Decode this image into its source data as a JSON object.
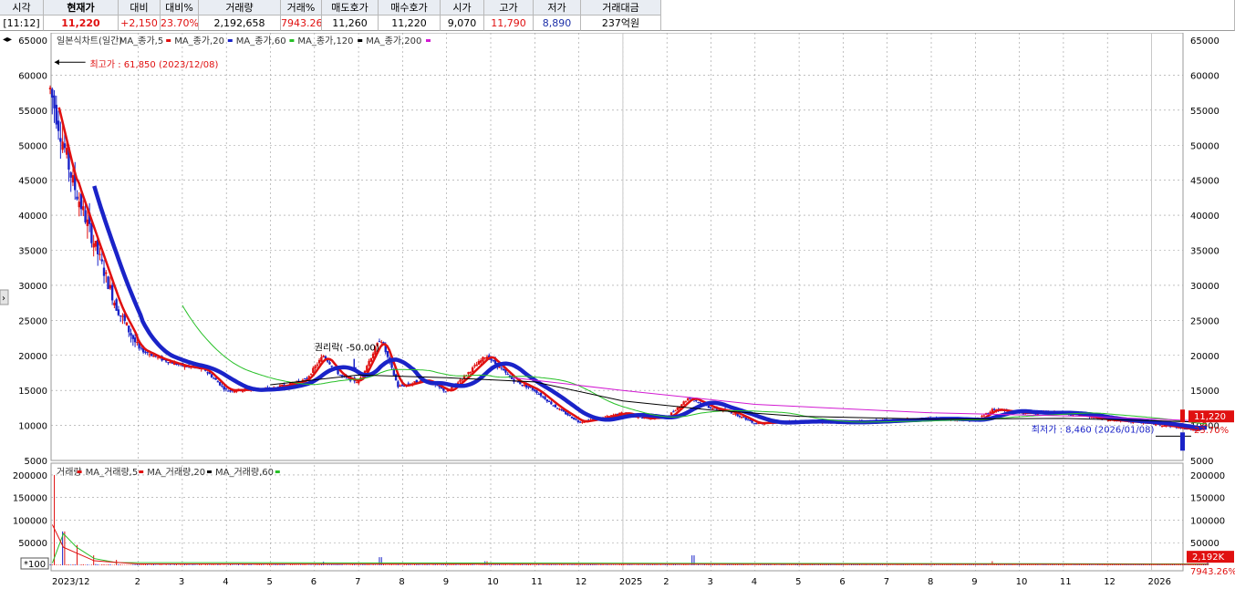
{
  "quote": {
    "headers": [
      "시각",
      "현재가",
      "대비",
      "대비%",
      "거래량",
      "거래%",
      "매도호가",
      "매수호가",
      "시가",
      "고가",
      "저가",
      "거래대금"
    ],
    "values": [
      "[11:12]",
      "11,220",
      "+2,150",
      "23.70%",
      "2,192,658",
      "7943.26%",
      "11,260",
      "11,220",
      "9,070",
      "11,790",
      "8,890",
      "237억원"
    ]
  },
  "colors": {
    "up": "#e01010",
    "down": "#1a23c8",
    "ma5": "#e01010",
    "ma20": "#1a23c8",
    "ma60": "#27c027",
    "ma120": "#000000",
    "ma200": "#d21ad2",
    "grid": "#9a9a9a"
  },
  "chart_data": {
    "type": "candlestick",
    "price_panel": {
      "legend": [
        "일본식차트(일간)",
        "MA_종가,5",
        "MA_종가,20",
        "MA_종가,60",
        "MA_종가,120",
        "MA_종가,200"
      ],
      "ylim": [
        5000,
        65000
      ],
      "yticks": [
        "65000",
        "60000",
        "55000",
        "50000",
        "45000",
        "40000",
        "35000",
        "30000",
        "25000",
        "20000",
        "15000",
        "10000",
        "5000"
      ],
      "high_annotation": "최고가 : 61,850 (2023/12/08)",
      "low_annotation": "최저가 : 8,460 (2026/01/08)",
      "event_annotation": "권리락( -50.00)",
      "current_price_tag": "11,220",
      "change_tag": "23.70%",
      "close_trend": [
        {
          "t": 0,
          "c": 58000
        },
        {
          "t": 0.5,
          "c": 45000
        },
        {
          "t": 1,
          "c": 36000
        },
        {
          "t": 1.5,
          "c": 27000
        },
        {
          "t": 2,
          "c": 21000
        },
        {
          "t": 2.5,
          "c": 19500
        },
        {
          "t": 3,
          "c": 18500
        },
        {
          "t": 3.5,
          "c": 18000
        },
        {
          "t": 4,
          "c": 15000
        },
        {
          "t": 5,
          "c": 15200
        },
        {
          "t": 5.8,
          "c": 16500
        },
        {
          "t": 6.2,
          "c": 20000
        },
        {
          "t": 6.6,
          "c": 17000
        },
        {
          "t": 7,
          "c": 16200
        },
        {
          "t": 7.5,
          "c": 22500
        },
        {
          "t": 7.9,
          "c": 15500
        },
        {
          "t": 8.5,
          "c": 16500
        },
        {
          "t": 9,
          "c": 14800
        },
        {
          "t": 9.4,
          "c": 17000
        },
        {
          "t": 9.9,
          "c": 20000
        },
        {
          "t": 10.5,
          "c": 16500
        },
        {
          "t": 11,
          "c": 15000
        },
        {
          "t": 11.5,
          "c": 12500
        },
        {
          "t": 12,
          "c": 10500
        },
        {
          "t": 12.5,
          "c": 11000
        },
        {
          "t": 13,
          "c": 11800
        },
        {
          "t": 13.5,
          "c": 11000
        },
        {
          "t": 14,
          "c": 11200
        },
        {
          "t": 14.5,
          "c": 14000
        },
        {
          "t": 15,
          "c": 12500
        },
        {
          "t": 15.5,
          "c": 11800
        },
        {
          "t": 16,
          "c": 10300
        },
        {
          "t": 17,
          "c": 10600
        },
        {
          "t": 18,
          "c": 10400
        },
        {
          "t": 19,
          "c": 10700
        },
        {
          "t": 20,
          "c": 11000
        },
        {
          "t": 21,
          "c": 10700
        },
        {
          "t": 21.4,
          "c": 12300
        },
        {
          "t": 22,
          "c": 11800
        },
        {
          "t": 23,
          "c": 11800
        },
        {
          "t": 24,
          "c": 10800
        },
        {
          "t": 25,
          "c": 10300
        },
        {
          "t": 26,
          "c": 9300
        },
        {
          "t": 26.3,
          "c": 11220
        }
      ],
      "ma120_trend": [
        {
          "t": 5,
          "c": 15800
        },
        {
          "t": 7,
          "c": 17200
        },
        {
          "t": 9,
          "c": 16800
        },
        {
          "t": 11,
          "c": 16200
        },
        {
          "t": 13,
          "c": 13500
        },
        {
          "t": 15,
          "c": 12200
        },
        {
          "t": 17,
          "c": 11300
        },
        {
          "t": 20,
          "c": 10900
        },
        {
          "t": 23,
          "c": 11000
        },
        {
          "t": 26,
          "c": 10500
        }
      ],
      "ma200_trend": [
        {
          "t": 10.5,
          "c": 16800
        },
        {
          "t": 13,
          "c": 15000
        },
        {
          "t": 16,
          "c": 13000
        },
        {
          "t": 20,
          "c": 11800
        },
        {
          "t": 23.5,
          "c": 11300
        },
        {
          "t": 26.3,
          "c": 10600
        }
      ]
    },
    "volume_panel": {
      "legend": [
        "거래량",
        "MA_거래량,5",
        "MA_거래량,20",
        "MA_거래량,60"
      ],
      "ylim": [
        0,
        210000
      ],
      "yticks": [
        "200000",
        "150000",
        "100000",
        "50000",
        "0"
      ],
      "unit_label": "*100",
      "volume_tag": "2,192K",
      "volume_pct_tag": "7943.26%",
      "spikes": [
        {
          "t": 0.1,
          "v": 200000
        },
        {
          "t": 0.3,
          "v": 75000
        },
        {
          "t": 0.6,
          "v": 45000
        },
        {
          "t": 1.0,
          "v": 22000
        },
        {
          "t": 1.5,
          "v": 12000
        },
        {
          "t": 6.2,
          "v": 8000
        },
        {
          "t": 7.5,
          "v": 18000
        },
        {
          "t": 9.9,
          "v": 9000
        },
        {
          "t": 14.6,
          "v": 22000
        },
        {
          "t": 21.4,
          "v": 9000
        },
        {
          "t": 26.3,
          "v": 15000
        }
      ]
    },
    "x_axis": {
      "labels": [
        "2023/12",
        "2",
        "3",
        "4",
        "5",
        "6",
        "7",
        "8",
        "9",
        "10",
        "11",
        "12",
        "2025",
        "2",
        "3",
        "4",
        "5",
        "6",
        "7",
        "8",
        "9",
        "10",
        "11",
        "12",
        "2026"
      ],
      "positions": [
        0,
        2,
        3,
        4,
        5,
        6,
        7,
        8,
        9,
        10,
        11,
        12,
        13,
        14,
        15,
        16,
        17,
        18,
        19,
        20,
        21,
        22,
        23,
        24,
        25
      ]
    }
  }
}
